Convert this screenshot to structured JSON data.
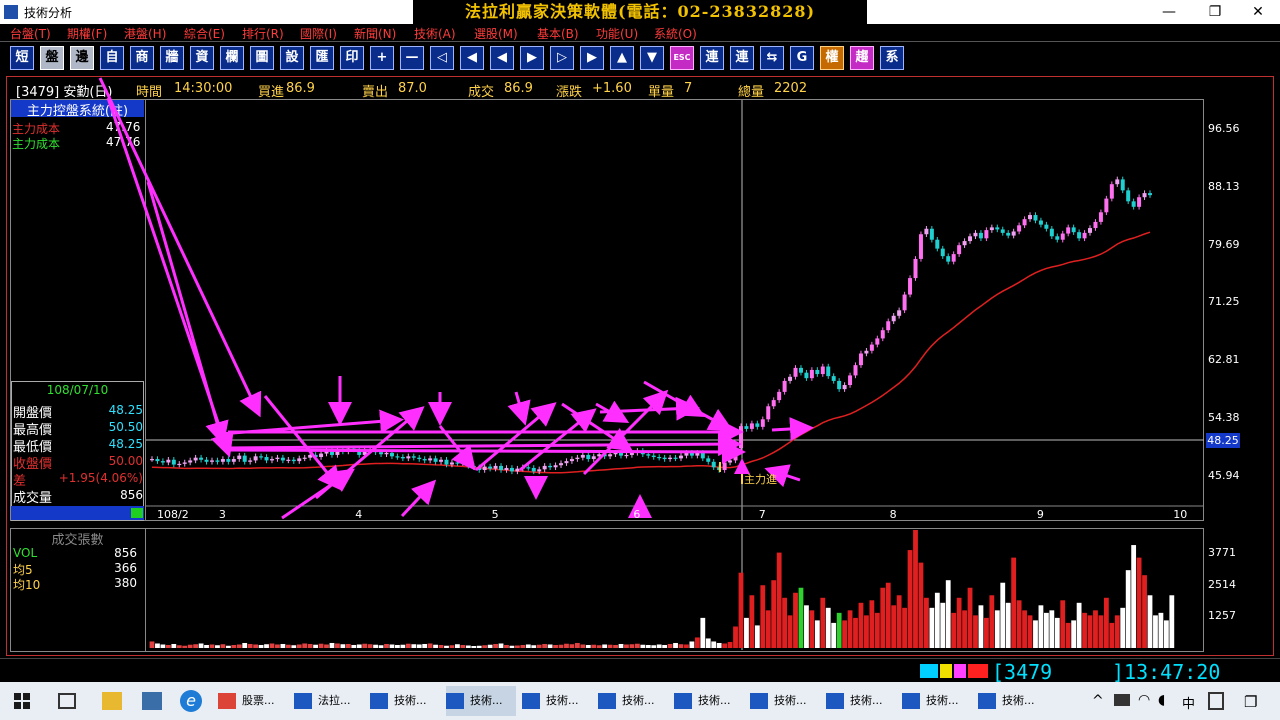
{
  "window": {
    "title": "技術分析",
    "banner": "法拉利贏家決策軟體(電話：02-23832828)",
    "min": "—",
    "max": "❐",
    "close": "✕"
  },
  "menu": [
    "台盤(T)",
    "期權(F)",
    "港盤(H)",
    "綜合(E)",
    "排行(R)",
    "國際(I)",
    "新聞(N)",
    "技術(A)",
    "選股(M)",
    "基本(B)",
    "功能(U)",
    "系統(O)"
  ],
  "toolbar": [
    "短",
    "盤",
    "邊",
    "自",
    "商",
    "牆",
    "資",
    "欄",
    "圖",
    "設",
    "匯",
    "印",
    "+",
    "—",
    "◁",
    "◀",
    "◀",
    "▶",
    "▷",
    "▶",
    "▲",
    "▼",
    "ESC",
    "連",
    "連",
    "⇆",
    "G",
    "權",
    "趨",
    "系"
  ],
  "info": {
    "code": "[3479] 安勤(日)",
    "time_label": "時間",
    "time": "14:30:00",
    "bid_label": "買進",
    "bid": "86.9",
    "ask_label": "賣出",
    "ask": "87.0",
    "deal_label": "成交",
    "deal": "86.9",
    "change_label": "漲跌",
    "change": "+1.60",
    "vol_label": "單量",
    "vol": "7",
    "total_label": "總量",
    "total": "2202"
  },
  "indicator": {
    "title": "主力控盤系統(註)",
    "row1_label": "主力成本",
    "row1_value": "47.76",
    "row2_label": "主力成本",
    "row2_value": "47.76"
  },
  "ohlc": {
    "date": "108/07/10",
    "rows": [
      {
        "label": "開盤價",
        "value": "48.25"
      },
      {
        "label": "最高價",
        "value": "50.50"
      },
      {
        "label": "最低價",
        "value": "48.25"
      },
      {
        "label": "收盤價",
        "value": "50.00"
      },
      {
        "label": "差",
        "value": "+1.95(4.06%)"
      },
      {
        "label": "成交量",
        "value": "856"
      }
    ]
  },
  "volume_panel": {
    "title": "成交張數",
    "rows": [
      {
        "label": "VOL",
        "value": "856"
      },
      {
        "label": "均5",
        "value": "366"
      },
      {
        "label": "均10",
        "value": "380"
      }
    ]
  },
  "annotation": "主力進",
  "price_marker": "48.25",
  "status": {
    "code": "3479",
    "clock": "13:47:20"
  },
  "taskbar": {
    "items": [
      "股票...",
      "法拉...",
      "技術...",
      "技術...",
      "技術...",
      "技術...",
      "技術...",
      "技術...",
      "技術...",
      "技術...",
      "技術..."
    ],
    "ime": "中",
    "notif": "❐"
  },
  "chart_data": {
    "type": "candlestick",
    "y_ticks": [
      96.56,
      88.13,
      79.69,
      71.25,
      62.81,
      54.38,
      45.94
    ],
    "x_ticks": [
      "108/2",
      "3",
      "4",
      "5",
      "6",
      "7",
      "8",
      "9",
      "10"
    ],
    "volume_ticks": [
      3771,
      2514,
      1257
    ],
    "ylim": [
      39.8,
      100.2
    ],
    "volume_max": 4700,
    "closes": [
      48.4,
      48.1,
      47.9,
      48.3,
      47.6,
      47.7,
      47.9,
      48.2,
      48.6,
      48.3,
      48.0,
      48.2,
      48.0,
      48.4,
      48.0,
      48.4,
      48.9,
      48.0,
      48.2,
      48.8,
      48.7,
      48.2,
      48.4,
      48.6,
      48.2,
      48.3,
      48.1,
      48.5,
      48.6,
      49.0,
      48.7,
      49.2,
      49.6,
      49.0,
      49.7,
      49.5,
      49.9,
      49.8,
      49.0,
      49.6,
      49.8,
      49.4,
      49.1,
      49.3,
      48.8,
      48.7,
      48.5,
      48.8,
      48.6,
      48.4,
      48.2,
      48.5,
      48.0,
      48.3,
      47.6,
      47.9,
      47.8,
      48.0,
      47.4,
      47.2,
      46.8,
      47.3,
      47.0,
      47.4,
      46.8,
      47.1,
      46.6,
      47.0,
      47.2,
      47.1,
      46.6,
      46.9,
      47.4,
      47.2,
      47.5,
      47.8,
      48.1,
      48.4,
      48.6,
      49.0,
      48.4,
      48.8,
      49.1,
      48.8,
      49.1,
      49.3,
      48.9,
      49.0,
      49.3,
      49.6,
      49.1,
      48.9,
      48.7,
      48.6,
      48.4,
      48.6,
      48.5,
      48.9,
      49.3,
      48.9,
      49.3,
      48.5,
      48.0,
      47.2,
      46.8,
      47.9,
      48.2,
      50.0,
      53.2,
      52.8,
      53.6,
      53.1,
      54.2,
      56.1,
      57.0,
      58.2,
      59.8,
      60.4,
      61.7,
      61.0,
      60.2,
      61.4,
      60.8,
      61.9,
      60.5,
      59.8,
      58.6,
      59.2,
      60.6,
      62.1,
      63.8,
      64.2,
      65.1,
      66.0,
      67.2,
      68.5,
      69.3,
      70.1,
      72.4,
      74.8,
      77.6,
      81.2,
      82.0,
      80.4,
      79.1,
      78.0,
      77.2,
      78.3,
      79.6,
      80.2,
      80.9,
      81.4,
      80.6,
      81.8,
      82.2,
      81.9,
      81.4,
      81.0,
      81.6,
      82.5,
      83.4,
      84.0,
      83.2,
      82.6,
      82.0,
      80.9,
      80.4,
      81.3,
      82.2,
      81.5,
      80.6,
      81.4,
      82.1,
      83.0,
      84.4,
      86.4,
      88.5,
      89.2,
      87.6,
      86.0,
      85.2,
      86.6,
      87.2,
      86.9
    ],
    "volumes": [
      260,
      180,
      140,
      120,
      160,
      110,
      90,
      130,
      150,
      180,
      120,
      140,
      110,
      150,
      90,
      120,
      140,
      200,
      160,
      140,
      120,
      150,
      180,
      140,
      160,
      130,
      110,
      140,
      180,
      160,
      130,
      170,
      140,
      200,
      180,
      150,
      160,
      120,
      140,
      170,
      150,
      130,
      110,
      160,
      140,
      120,
      130,
      170,
      150,
      140,
      160,
      180,
      130,
      120,
      90,
      110,
      150,
      120,
      100,
      80,
      90,
      110,
      130,
      160,
      180,
      120,
      90,
      100,
      120,
      140,
      110,
      130,
      160,
      140,
      120,
      130,
      170,
      150,
      200,
      140,
      120,
      130,
      110,
      140,
      130,
      120,
      160,
      140,
      150,
      170,
      130,
      120,
      110,
      140,
      120,
      160,
      200,
      150,
      140,
      260,
      420,
      1200,
      380,
      260,
      200,
      180,
      240,
      856,
      3000,
      1200,
      2100,
      900,
      2500,
      1500,
      2700,
      3800,
      2000,
      1300,
      2200,
      2400,
      1700,
      1500,
      1100,
      2000,
      1600,
      1000,
      1400,
      1100,
      1500,
      1200,
      1800,
      1300,
      1900,
      1400,
      2400,
      2600,
      1700,
      2100,
      1600,
      3900,
      4700,
      3400,
      2000,
      1600,
      2200,
      1800,
      2700,
      1400,
      2000,
      1500,
      2400,
      1300,
      1700,
      1200,
      2100,
      1500,
      2600,
      1800,
      3600,
      1900,
      1500,
      1300,
      1100,
      1700,
      1400,
      1500,
      1200,
      1900,
      1000,
      1100,
      1800,
      1400,
      1300,
      1500,
      1300,
      2000,
      1000,
      1300,
      1600,
      3100,
      4100,
      3600,
      2900,
      2100,
      1300,
      1400,
      1100,
      2100
    ]
  }
}
